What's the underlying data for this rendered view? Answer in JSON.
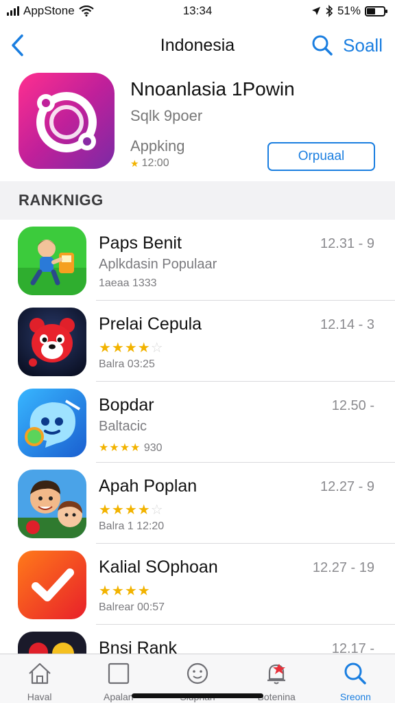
{
  "status_bar": {
    "carrier": "AppStone",
    "time": "13:34",
    "battery_text": "51%",
    "battery_level": 0.51
  },
  "nav": {
    "title": "Indonesia",
    "search_label": "Soall",
    "accent_color": "#1a7ee0"
  },
  "featured": {
    "icon": "ring-logo-icon",
    "title": "Nnoanlasia 1Powin",
    "subtitle": "Sqlk 9poer",
    "category": "Appking",
    "meta": "12:00",
    "button_label": "Orpuaal"
  },
  "section_title": "RANKNIGG",
  "apps": [
    {
      "name": "Paps Benit",
      "time": "12.31 - 9",
      "subtitle": "Aplkdasin Populaar",
      "rating": null,
      "meta": "1aeaa 1333",
      "icon": "character-game-icon"
    },
    {
      "name": "Prelai Cepula",
      "time": "12.14 - 3",
      "subtitle": "",
      "rating": 4,
      "rating_max": 5,
      "meta": "Balra 03:25",
      "icon": "red-bear-icon"
    },
    {
      "name": "Bopdar",
      "time": "12.50 -",
      "subtitle": "Baltacic",
      "rating": 3.5,
      "rating_max": 5,
      "meta": "930",
      "icon": "blue-mascot-icon"
    },
    {
      "name": "Apah Poplan",
      "time": "12.27 - 9",
      "subtitle": "",
      "rating": 4,
      "rating_max": 5,
      "meta": "Balra 1 12:20",
      "icon": "cartoon-kids-icon"
    },
    {
      "name": "Kalial SOphoan",
      "time": "12.27 - 19",
      "subtitle": "",
      "rating": 4,
      "rating_max": 5,
      "meta": "Balrear 00:57",
      "icon": "checkmark-icon"
    },
    {
      "name": "Bnsi Rank",
      "time": "12.17 -",
      "subtitle": "",
      "rating": null,
      "meta": "",
      "icon": "game-character-icon"
    }
  ],
  "tabs": [
    {
      "label": "Haval",
      "icon": "home-icon",
      "active": false
    },
    {
      "label": "Apalan",
      "icon": "square-icon",
      "active": false
    },
    {
      "label": "Sluphan",
      "icon": "smiley-icon",
      "active": false
    },
    {
      "label": "Botenina",
      "icon": "notification-bell-icon",
      "active": false
    },
    {
      "label": "Sreonn",
      "icon": "search-icon",
      "active": true
    }
  ]
}
